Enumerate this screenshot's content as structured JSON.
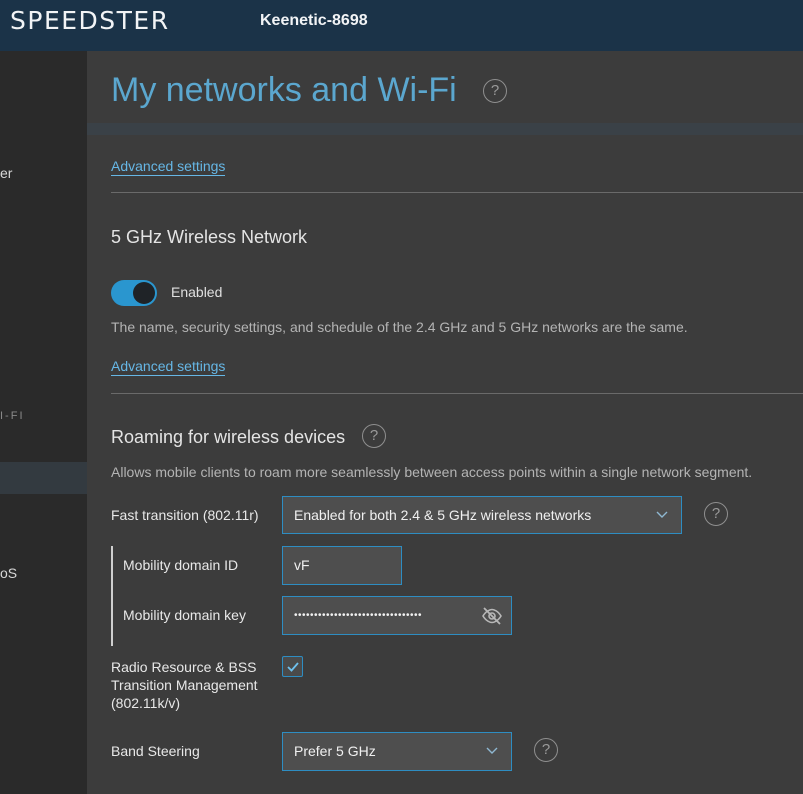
{
  "header": {
    "logo": "SPEEDSTER",
    "device_name": "Keenetic-8698"
  },
  "sidebar": {
    "item_user": "er",
    "section_wifi": "I-FI",
    "item_qos": "oS"
  },
  "page": {
    "title": "My networks and Wi-Fi",
    "help": "?"
  },
  "section_24": {
    "advanced_link": "Advanced settings"
  },
  "section_5ghz": {
    "heading": "5 GHz Wireless Network",
    "toggle_label": "Enabled",
    "toggle_enabled": true,
    "description": "The name, security settings, and schedule of the 2.4 GHz and 5 GHz networks are the same.",
    "advanced_link": "Advanced settings"
  },
  "roaming": {
    "heading": "Roaming for wireless devices",
    "help": "?",
    "description": "Allows mobile clients to roam more seamlessly between access points within a single network segment.",
    "fast_transition_label": "Fast transition (802.11r)",
    "fast_transition_value": "Enabled for both 2.4 & 5 GHz wireless networks",
    "fast_transition_help": "?",
    "mobility_domain_id_label": "Mobility domain ID",
    "mobility_domain_id_value": "vF",
    "mobility_domain_key_label": "Mobility domain key",
    "mobility_domain_key_value": "••••••••••••••••••••••••••••••••",
    "rrm_label_line1": "Radio Resource & BSS",
    "rrm_label_line2": "Transition Management",
    "rrm_label_line3": "(802.11k/v)",
    "rrm_checked": true,
    "band_steering_label": "Band Steering",
    "band_steering_value": "Prefer 5 GHz",
    "band_steering_help": "?"
  },
  "colors": {
    "accent": "#2e8dc2",
    "title": "#5ba7cf",
    "link": "#66b7e6",
    "header_bg": "#1b3348"
  },
  "icons": {
    "help": "question-circle-icon",
    "chevron": "chevron-down-icon",
    "eye": "eye-slash-icon",
    "check": "checkmark-icon"
  }
}
